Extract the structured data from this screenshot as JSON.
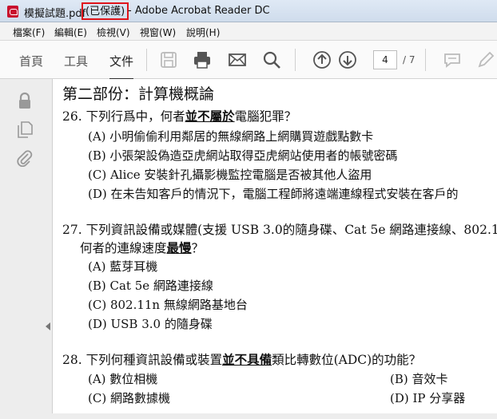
{
  "window": {
    "file_name": "模擬試題.pdf",
    "protected_label": "(已保護)",
    "app_title": "- Adobe Acrobat Reader DC"
  },
  "menu": [
    "檔案(F)",
    "編輯(E)",
    "檢視(V)",
    "視窗(W)",
    "說明(H)"
  ],
  "toolbar": {
    "home": "首頁",
    "tools": "工具",
    "document": "文件",
    "page_current": "4",
    "page_total": "/ 7"
  },
  "document": {
    "section_title": "第二部份：計算機概論",
    "q26": {
      "pre": "26. 下列行爲中，何者",
      "emph": "並不屬於",
      "post": "電腦犯罪？",
      "options": [
        "(A)  小明偷偷利用鄰居的無線網路上網購買遊戲點數卡",
        "(B)  小張架設偽造亞虎網站取得亞虎網站使用者的帳號密碼",
        "(C)   Alice 安裝針孔攝影機監控電腦是否被其他人盜用",
        "(D)  在未告知客戶的情況下，電腦工程師將遠端連線程式安裝在客戶的"
      ]
    },
    "q27": {
      "line1": "27. 下列資訊設備或媒體(支援 USB 3.0的隨身碟、Cat 5e 網路連接線、802.1",
      "line2_pre": "何者的連線速度",
      "line2_emph": "最慢",
      "line2_post": "？",
      "options": [
        "(A)  藍芽耳機",
        "(B)   Cat 5e 網路連接線",
        "(C)   802.11n 無線網路基地台",
        "(D)   USB 3.0 的隨身碟"
      ]
    },
    "q28": {
      "pre": "28. 下列何種資訊設備或裝置",
      "emph": "並不具備",
      "post": "類比轉數位(ADC)的功能？",
      "options_left": [
        "(A)  數位相機",
        "(C)  網路數據機"
      ],
      "options_right": [
        "(B)  音效卡",
        "(D)   IP 分享器"
      ]
    }
  },
  "icons": {
    "save": "save-icon",
    "print": "print-icon",
    "mail": "mail-icon",
    "search": "search-icon",
    "prev": "arrow-up-circle-icon",
    "next": "arrow-down-circle-icon",
    "comment": "comment-icon",
    "pen": "pen-icon",
    "lock": "lock-icon",
    "copy": "pages-icon",
    "attach": "paperclip-icon"
  }
}
